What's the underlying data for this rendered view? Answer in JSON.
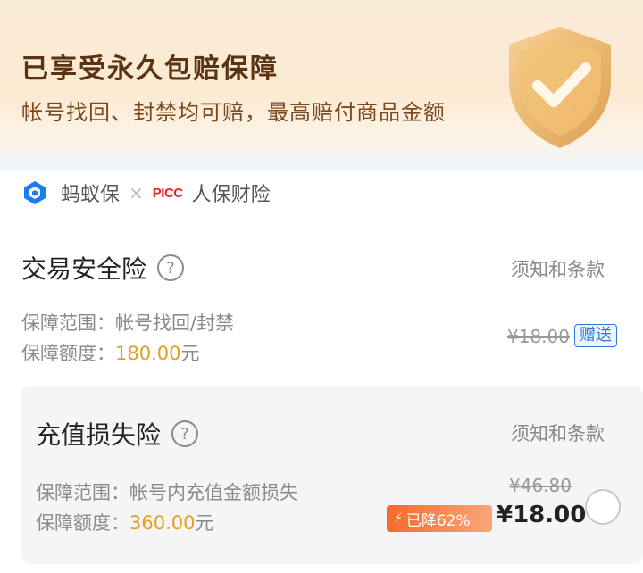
{
  "hero": {
    "title": "已享受永久包赔保障",
    "subtitle": "帐号找回、封禁均可赔，最高赔付商品金额"
  },
  "partners": {
    "ant_name": "蚂蚁保",
    "separator": "×",
    "picc_logo": "PICC",
    "picc_name": "人保财险"
  },
  "insurance_1": {
    "title": "交易安全险",
    "help": "?",
    "terms": "须知和条款",
    "scope_label": "保障范围：",
    "scope_value": "帐号找回/封禁",
    "amount_label": "保障额度：",
    "amount_value": "180.00",
    "amount_unit": "元",
    "original_price": "¥18.00",
    "gift_label": "赠送"
  },
  "insurance_2": {
    "title": "充值损失险",
    "help": "?",
    "terms": "须知和条款",
    "scope_label": "保障范围：",
    "scope_value": "帐号内充值金额损失",
    "amount_label": "保障额度：",
    "amount_value": "360.00",
    "amount_unit": "元",
    "original_price": "¥46.80",
    "discount_label": "已降62%",
    "price": "¥18.00",
    "selected": false
  },
  "colors": {
    "accent_gold": "#e0a020",
    "discount_orange": "#f56a2a",
    "gift_blue": "#2a7bd8",
    "hero_text": "#5a3412"
  },
  "icons": {
    "shield": "shield-check-icon",
    "ant": "ant-insurance-logo-icon",
    "help": "question-circle-icon",
    "bolt": "lightning-icon"
  }
}
